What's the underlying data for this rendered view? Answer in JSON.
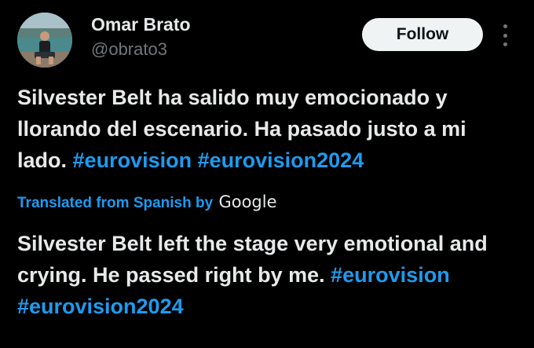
{
  "author": {
    "display_name": "Omar Brato",
    "handle": "@obrato3"
  },
  "actions": {
    "follow_label": "Follow"
  },
  "original": {
    "text": "Silvester Belt ha salido muy emocionado y llorando del escenario. Ha pasado justo a mi lado.",
    "hashtags": [
      "#eurovision",
      "#eurovision2024"
    ]
  },
  "translation": {
    "label": "Translated from Spanish by",
    "provider": "Google",
    "text": "Silvester Belt left the stage very emotional and crying. He passed right by me.",
    "hashtags": [
      "#eurovision",
      "#eurovision2024"
    ]
  },
  "colors": {
    "background": "#000000",
    "text": "#e7e9ea",
    "secondary": "#71767b",
    "link": "#1d9bf0",
    "button_bg": "#eff3f4"
  },
  "icons": {
    "more": "more-vertical-icon"
  }
}
